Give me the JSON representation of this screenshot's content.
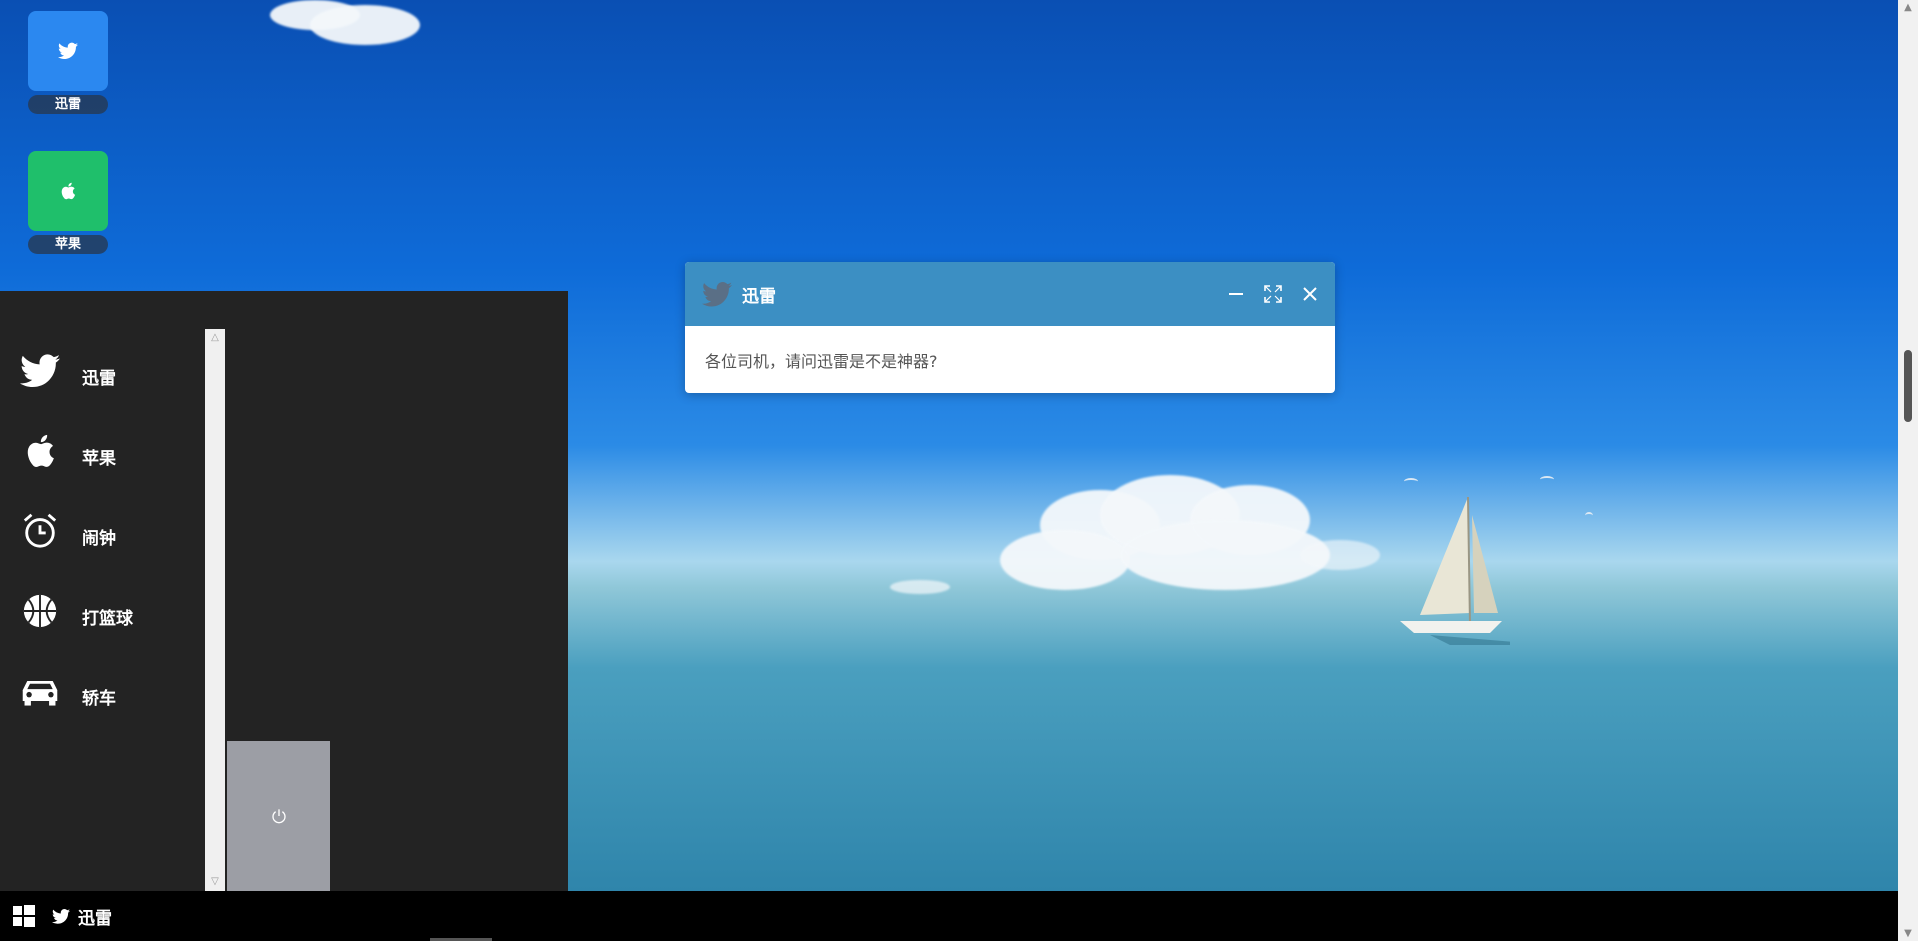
{
  "desktop": {
    "icons": [
      {
        "label": "迅雷",
        "color": "#2b88f0",
        "icon": "twitter-bird-icon"
      },
      {
        "label": "苹果",
        "color": "#1fbf6b",
        "icon": "apple-icon"
      }
    ]
  },
  "start_menu": {
    "items": [
      {
        "label": "迅雷",
        "icon": "twitter-bird-icon"
      },
      {
        "label": "苹果",
        "icon": "apple-icon"
      },
      {
        "label": "闹钟",
        "icon": "alarm-clock-icon"
      },
      {
        "label": "打篮球",
        "icon": "basketball-icon"
      },
      {
        "label": "轿车",
        "icon": "car-icon"
      }
    ],
    "power_icon": "power-icon"
  },
  "dialog": {
    "title": "迅雷",
    "message": "各位司机，请问迅雷是不是神器?",
    "titlebar_color": "#3c8fc3"
  },
  "taskbar": {
    "start_icon": "windows-logo-icon",
    "app_label": "迅雷"
  }
}
